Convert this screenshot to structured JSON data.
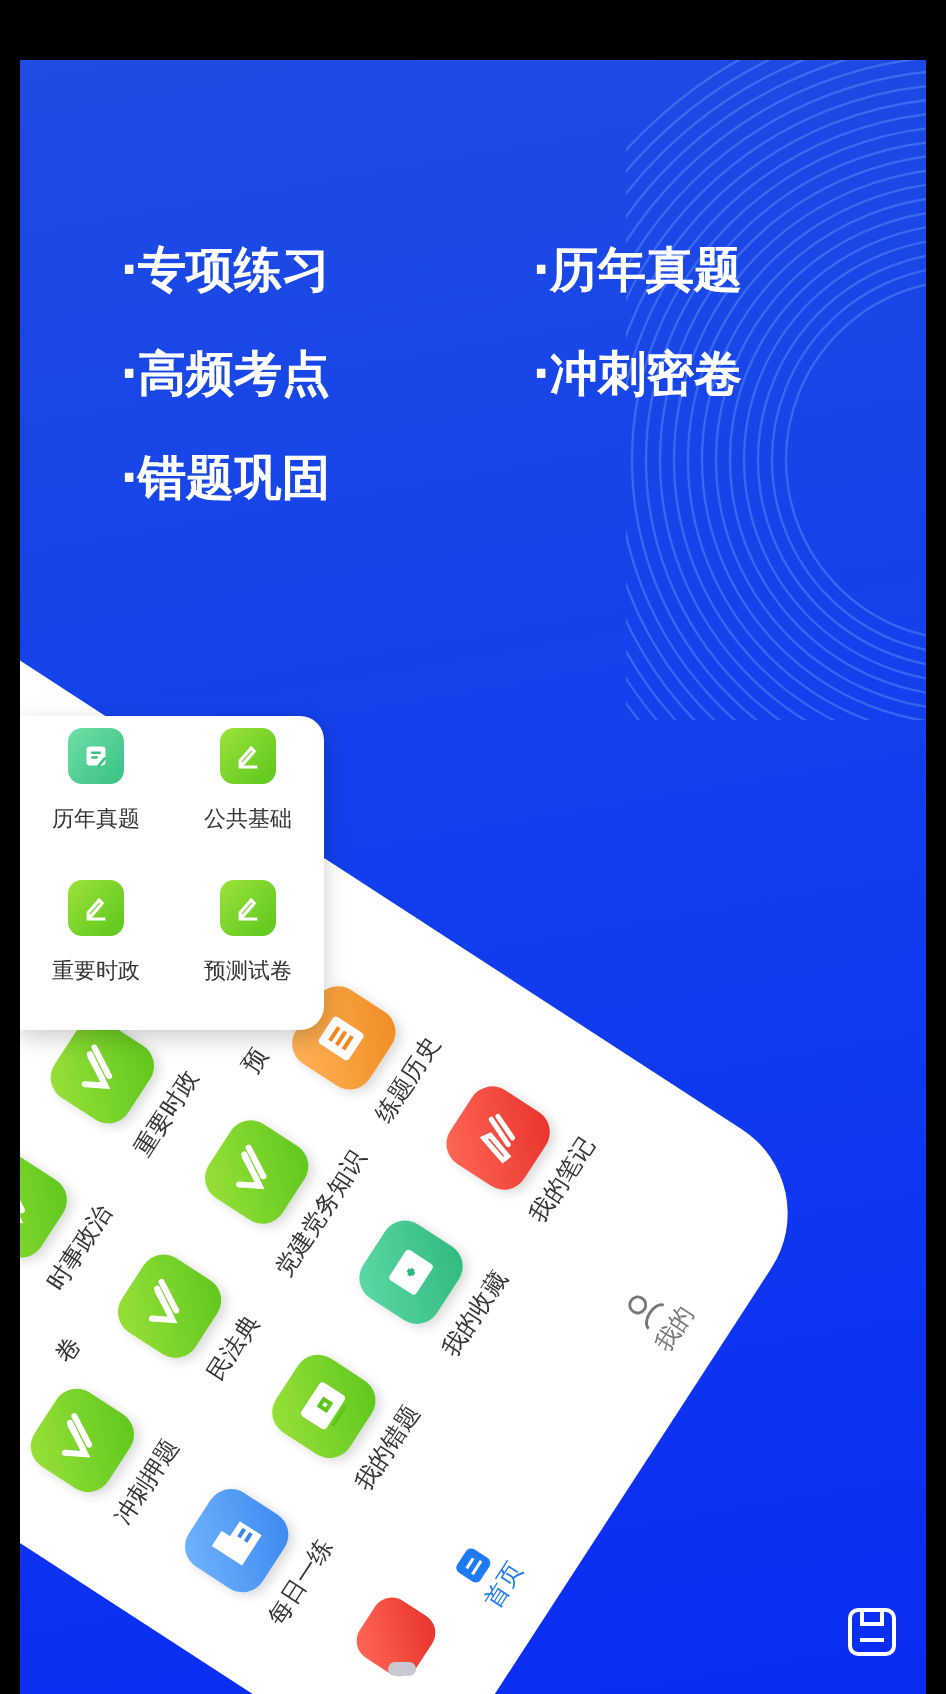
{
  "features": [
    "·专项练习",
    "·历年真题",
    "·高频考点",
    "·冲刺密卷",
    "·错题巩固"
  ],
  "menu_card": {
    "items": [
      {
        "label": "历年真题",
        "kind": "notepad"
      },
      {
        "label": "公共基础",
        "kind": "pen"
      },
      {
        "label": "重要时政",
        "kind": "pen"
      },
      {
        "label": "预测试卷",
        "kind": "pen"
      }
    ]
  },
  "phone": {
    "grid": [
      [
        {
          "label": "卷",
          "kind": "label-end"
        },
        {
          "label": "时事政治",
          "kind": "check"
        },
        {
          "label": "重要时政",
          "kind": "check"
        },
        {
          "label": "预",
          "kind": "label-start"
        }
      ],
      [
        {
          "label": "冲刺押题",
          "kind": "check"
        },
        {
          "label": "民法典",
          "kind": "check"
        },
        {
          "label": "党建党务知识",
          "kind": "check"
        },
        {
          "label": "练题历史",
          "kind": "document"
        }
      ],
      [
        {
          "label": "每日一练",
          "kind": "book"
        },
        {
          "label": "我的错题",
          "kind": "screen"
        },
        {
          "label": "我的收藏",
          "kind": "folder"
        },
        {
          "label": "我的笔记",
          "kind": "note"
        }
      ]
    ],
    "tabs": [
      {
        "label": "首页",
        "kind": "home",
        "selected": true
      },
      {
        "label": "我的",
        "kind": "person",
        "selected": false
      }
    ]
  }
}
